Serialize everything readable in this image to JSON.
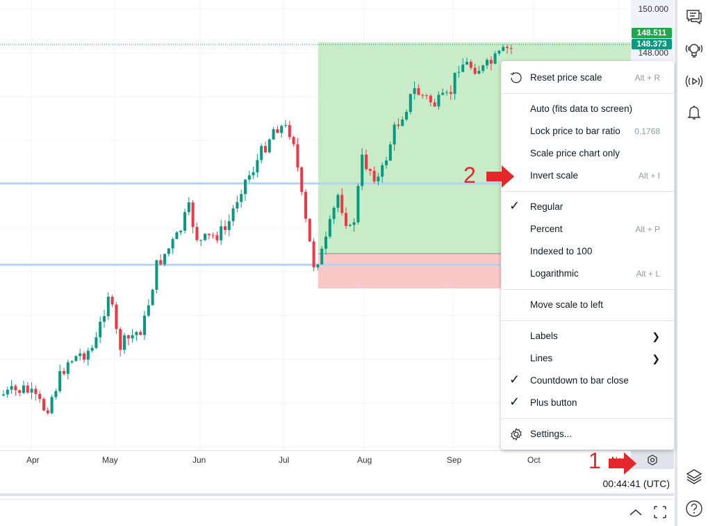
{
  "price_axis": {
    "ticks": [
      "150.000",
      "148.000"
    ],
    "last_price": "148.511",
    "last_price_color": "#1ea84b",
    "prev_price": "148.373",
    "prev_price_color": "#089981"
  },
  "time_axis": {
    "labels": [
      "Apr",
      "May",
      "Jun",
      "Jul",
      "Aug",
      "Sep",
      "Oct",
      "Nov"
    ]
  },
  "status": {
    "clock": "00:44:41 (UTC)"
  },
  "colors": {
    "up": "#089981",
    "down": "#f23645",
    "level_line": "#b3d4f0",
    "profit_zone": "#c8ebc8",
    "loss_zone": "#fbc8c8",
    "annotation": "#e5262a"
  },
  "menu": {
    "reset": {
      "label": "Reset price scale",
      "shortcut": "Alt + R",
      "icon": "reset-icon"
    },
    "auto": {
      "label": "Auto (fits data to screen)"
    },
    "lock": {
      "label": "Lock price to bar ratio",
      "value": "0.1768"
    },
    "scale_only": {
      "label": "Scale price chart only"
    },
    "invert": {
      "label": "Invert scale",
      "shortcut": "Alt + I"
    },
    "regular": {
      "label": "Regular",
      "checked": true
    },
    "percent": {
      "label": "Percent",
      "shortcut": "Alt + P"
    },
    "indexed": {
      "label": "Indexed to 100"
    },
    "log": {
      "label": "Logarithmic",
      "shortcut": "Alt + L"
    },
    "move_left": {
      "label": "Move scale to left"
    },
    "labels": {
      "label": "Labels"
    },
    "lines": {
      "label": "Lines"
    },
    "countdown": {
      "label": "Countdown to bar close",
      "checked": true
    },
    "plus": {
      "label": "Plus button",
      "checked": true
    },
    "settings": {
      "label": "Settings...",
      "icon": "gear-icon"
    }
  },
  "annotations": {
    "step1": "1",
    "step2": "2"
  },
  "right_toolbar": [
    "chat-icon",
    "ideas-icon",
    "stream-icon",
    "alert-bell-icon",
    "layers-icon",
    "help-icon"
  ]
}
